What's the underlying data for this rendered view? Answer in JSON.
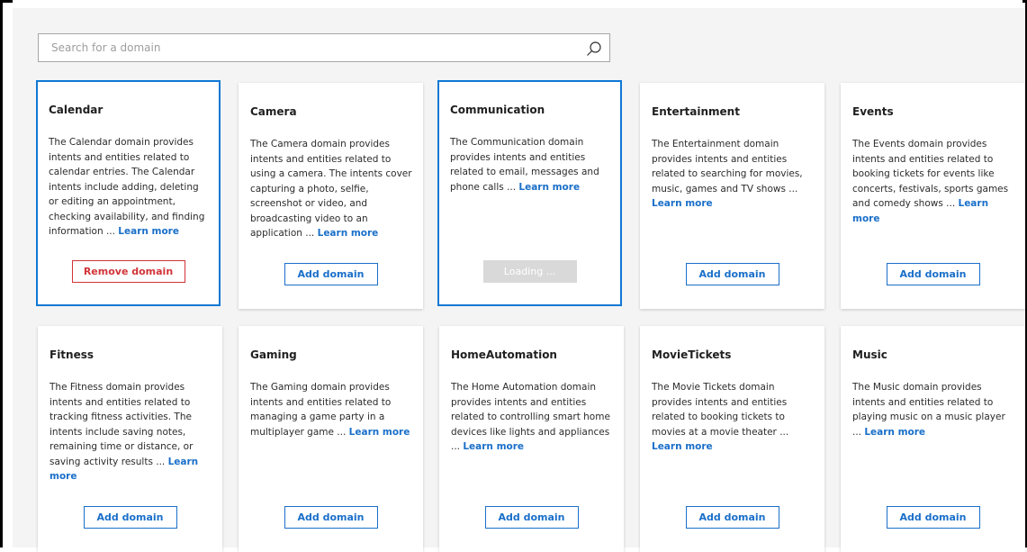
{
  "search": {
    "placeholder": "Search for a domain",
    "value": ""
  },
  "colors": {
    "accent": "#1a6fc9",
    "selected_border": "#0f78d4",
    "remove": "#d13438",
    "loading_bg": "#d9d9d9"
  },
  "learn_more": "Learn more",
  "cards": [
    {
      "title": "Calendar",
      "desc": "The Calendar domain provides intents and entities related to calendar entries. The Calendar intents include adding, deleting or editing an appointment, checking availability, and finding information ...",
      "button": "Remove domain",
      "state": "added"
    },
    {
      "title": "Camera",
      "desc": "The Camera domain provides intents and entities related to using a camera. The intents cover capturing a photo, selfie, screenshot or video, and broadcasting video to an application ...",
      "button": "Add domain",
      "state": "available"
    },
    {
      "title": "Communication",
      "desc": "The Communication domain provides intents and entities related to email, messages and phone calls ...",
      "button": "Loading ...",
      "state": "loading"
    },
    {
      "title": "Entertainment",
      "desc": "The Entertainment domain provides intents and entities related to searching for movies, music, games and TV shows ...",
      "button": "Add domain",
      "state": "available"
    },
    {
      "title": "Events",
      "desc": "The Events domain provides intents and entities related to booking tickets for events like concerts, festivals, sports games and comedy shows ...",
      "button": "Add domain",
      "state": "available"
    },
    {
      "title": "Fitness",
      "desc": "The Fitness domain provides intents and entities related to tracking fitness activities. The intents include saving notes, remaining time or distance, or saving activity results ...",
      "button": "Add domain",
      "state": "available"
    },
    {
      "title": "Gaming",
      "desc": "The Gaming domain provides intents and entities related to managing a game party in a multiplayer game ...",
      "button": "Add domain",
      "state": "available"
    },
    {
      "title": "HomeAutomation",
      "desc": "The Home Automation domain provides intents and entities related to controlling smart home devices like lights and appliances ...",
      "button": "Add domain",
      "state": "available"
    },
    {
      "title": "MovieTickets",
      "desc": "The Movie Tickets domain provides intents and entities related to booking tickets to movies at a movie theater ...",
      "button": "Add domain",
      "state": "available"
    },
    {
      "title": "Music",
      "desc": "The Music domain provides intents and entities related to playing music on a music player ...",
      "button": "Add domain",
      "state": "available"
    }
  ]
}
